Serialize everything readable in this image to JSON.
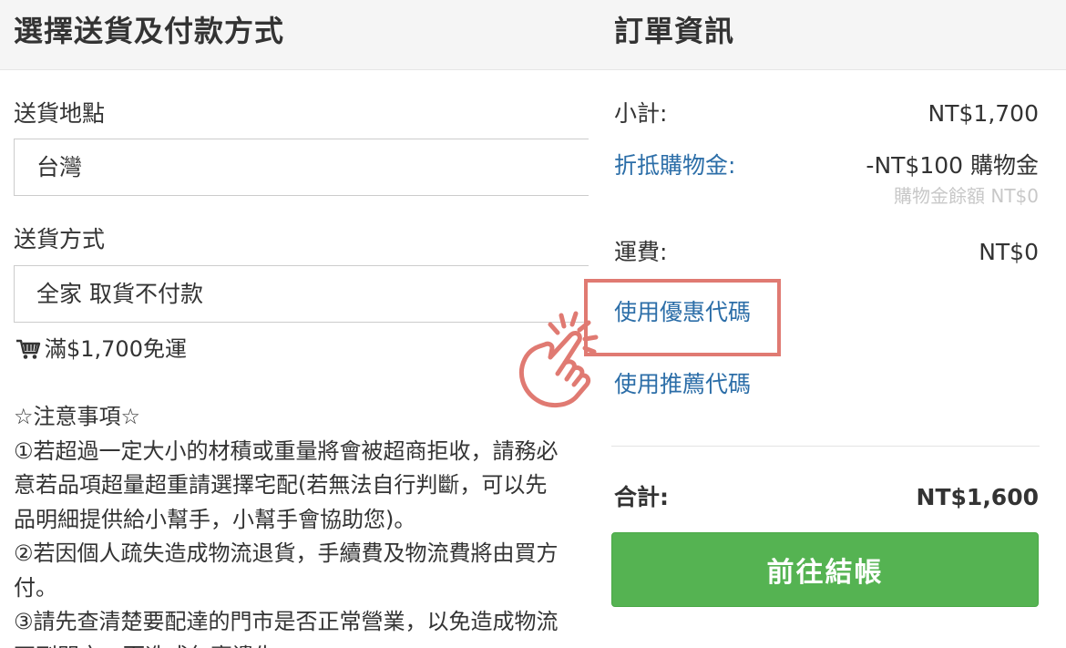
{
  "left_panel": {
    "title": "選擇送貨及付款方式",
    "delivery_location": {
      "label": "送貨地點",
      "value": "台灣"
    },
    "delivery_method": {
      "label": "送貨方式",
      "value": "全家 取貨不付款"
    },
    "free_shipping_note": "滿$1,700免運",
    "notes": [
      "☆注意事項☆",
      "①若超過一定大小的材積或重量將會被超商拒收，請務必",
      "意若品項超量超重請選擇宅配(若無法自行判斷，可以先",
      "品明細提供給小幫手，小幫手會協助您)。",
      "②若因個人疏失造成物流退貨，手續費及物流費將由買方",
      "付。",
      "③請先查清楚要配達的門市是否正常營業，以免造成物流",
      "不到門市，而造成包裹遺失。"
    ]
  },
  "right_panel": {
    "title": "訂單資訊",
    "subtotal": {
      "label": "小計:",
      "value": "NT$1,700"
    },
    "credit": {
      "label": "折抵購物金:",
      "value": "-NT$100 購物金",
      "balance": "購物金餘額 NT$0"
    },
    "shipping": {
      "label": "運費:",
      "value": "NT$0"
    },
    "coupon_link": "使用優惠代碼",
    "referral_link": "使用推薦代碼",
    "total": {
      "label": "合計:",
      "value": "NT$1,600"
    },
    "checkout_label": "前往結帳"
  },
  "colors": {
    "link": "#2c6ea8",
    "checkout_button": "#55b352",
    "highlight": "#e07a72"
  },
  "icons": [
    "cart-icon",
    "pointing-hand-icon"
  ]
}
